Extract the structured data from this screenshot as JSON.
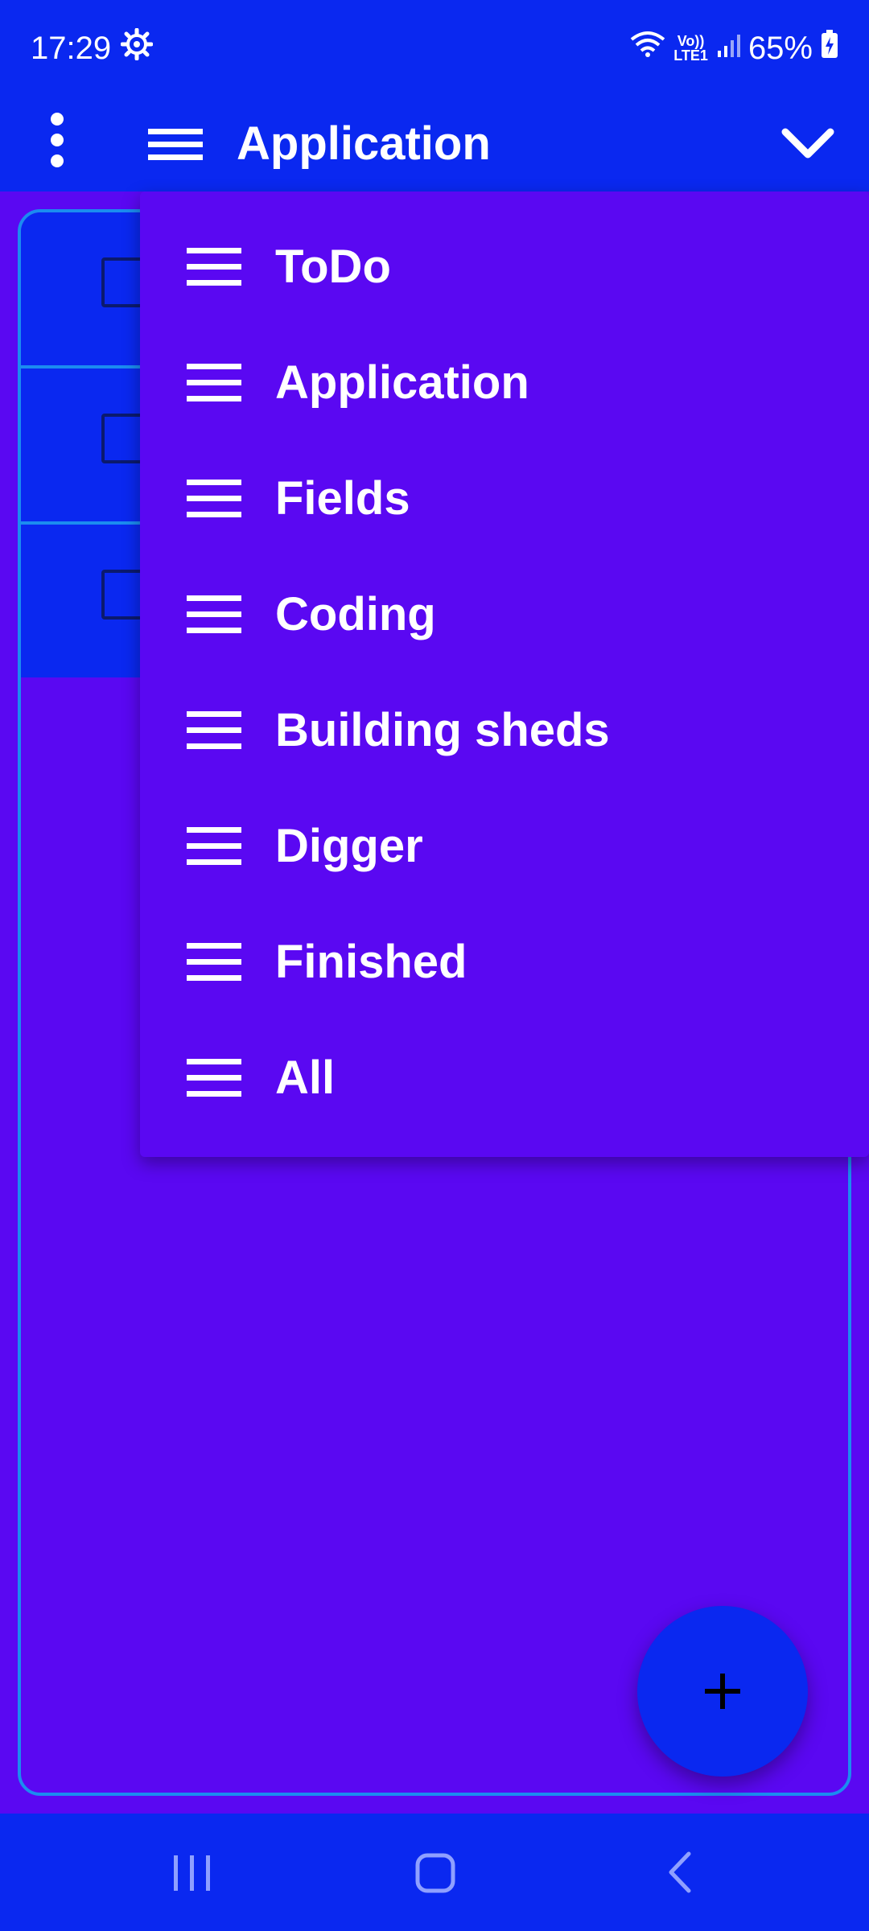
{
  "status_bar": {
    "time": "17:29",
    "battery": "65%",
    "network_top": "Vo))",
    "network_bottom": "LTE1",
    "icons": [
      "settings-gear-icon",
      "wifi-icon",
      "signal-icon",
      "battery-icon"
    ]
  },
  "app_bar": {
    "title": "Application",
    "icons": [
      "overflow-menu-icon",
      "list-icon",
      "chevron-down-icon"
    ]
  },
  "dropdown": {
    "items": [
      {
        "label": "ToDo"
      },
      {
        "label": "Application"
      },
      {
        "label": "Fields"
      },
      {
        "label": "Coding"
      },
      {
        "label": "Building sheds"
      },
      {
        "label": "Digger"
      },
      {
        "label": "Finished"
      },
      {
        "label": "All"
      }
    ]
  },
  "fab": {
    "icon": "plus-icon"
  },
  "nav_bar": {
    "icons": [
      "recents-icon",
      "home-icon",
      "back-icon"
    ]
  },
  "colors": {
    "primary": "#0a28f0",
    "background": "#5a08f2",
    "accent_border": "#1b8cf0",
    "text": "#ffffff"
  }
}
